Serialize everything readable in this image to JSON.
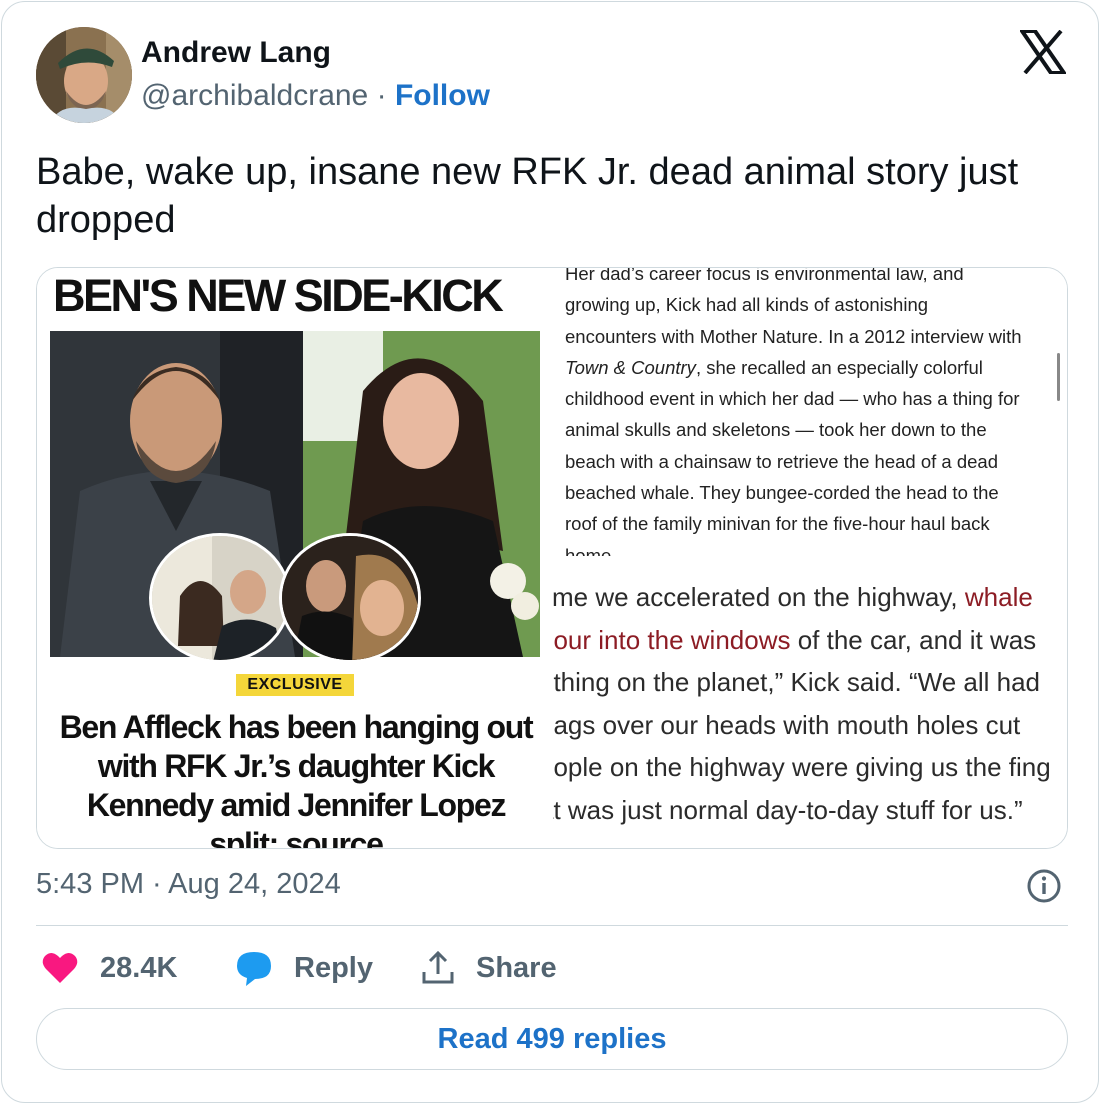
{
  "author": {
    "name": "Andrew Lang",
    "handle": "@archibaldcrane",
    "separator": "·",
    "follow_label": "Follow"
  },
  "tweet": {
    "text": "Babe, wake up, insane new RFK Jr. dead animal story just dropped"
  },
  "media": {
    "headline_top": "BEN'S NEW SIDE-KICK",
    "badge": "EXCLUSIVE",
    "headline_bottom": "Ben Affleck has been hanging out with RFK Jr.’s daughter Kick Kennedy amid Jennifer Lopez split: source",
    "excerpt": {
      "l1": "Her dad’s career focus is environmental law, and",
      "l2": "growing up, Kick had all kinds of astonishing",
      "l3": "encounters with Mother Nature. In a 2012 interview with",
      "l4_italic": "Town & Country",
      "l4_rest": ", she recalled an especially colorful",
      "l5": "childhood event in which her dad — who has a thing for",
      "l6": "animal skulls and skeletons — took her down to the",
      "l7": "beach with a chainsaw to retrieve the head of a dead",
      "l8": "beached whale. They bungee-corded the head to the",
      "l9": "roof of the family minivan for the five-hour haul back",
      "l10": "home."
    },
    "quote": {
      "l1a": "time we accelerated on the highway, ",
      "l1b": "whale",
      "l2a": "pour into the windows",
      "l2b": " of the car, and it was",
      "l3": "t thing on the planet,” Kick said. “We all had",
      "l4": "bags over our heads with mouth holes cut",
      "l5": "eople on the highway were giving us the fing",
      "l6": "at was just normal day-to-day stuff for us.”"
    }
  },
  "meta": {
    "timestamp": "5:43 PM · Aug 24, 2024"
  },
  "actions": {
    "likes": "28.4K",
    "reply_label": "Reply",
    "share_label": "Share",
    "read_replies_label": "Read 499 replies"
  },
  "colors": {
    "link": "#1d72c8",
    "like": "#f91880",
    "reply": "#1d9bf0",
    "muted": "#536471",
    "quote_red": "#8c1c24"
  },
  "icons": [
    "x-logo-icon",
    "heart-icon",
    "reply-bubble-icon",
    "share-icon",
    "info-icon"
  ]
}
